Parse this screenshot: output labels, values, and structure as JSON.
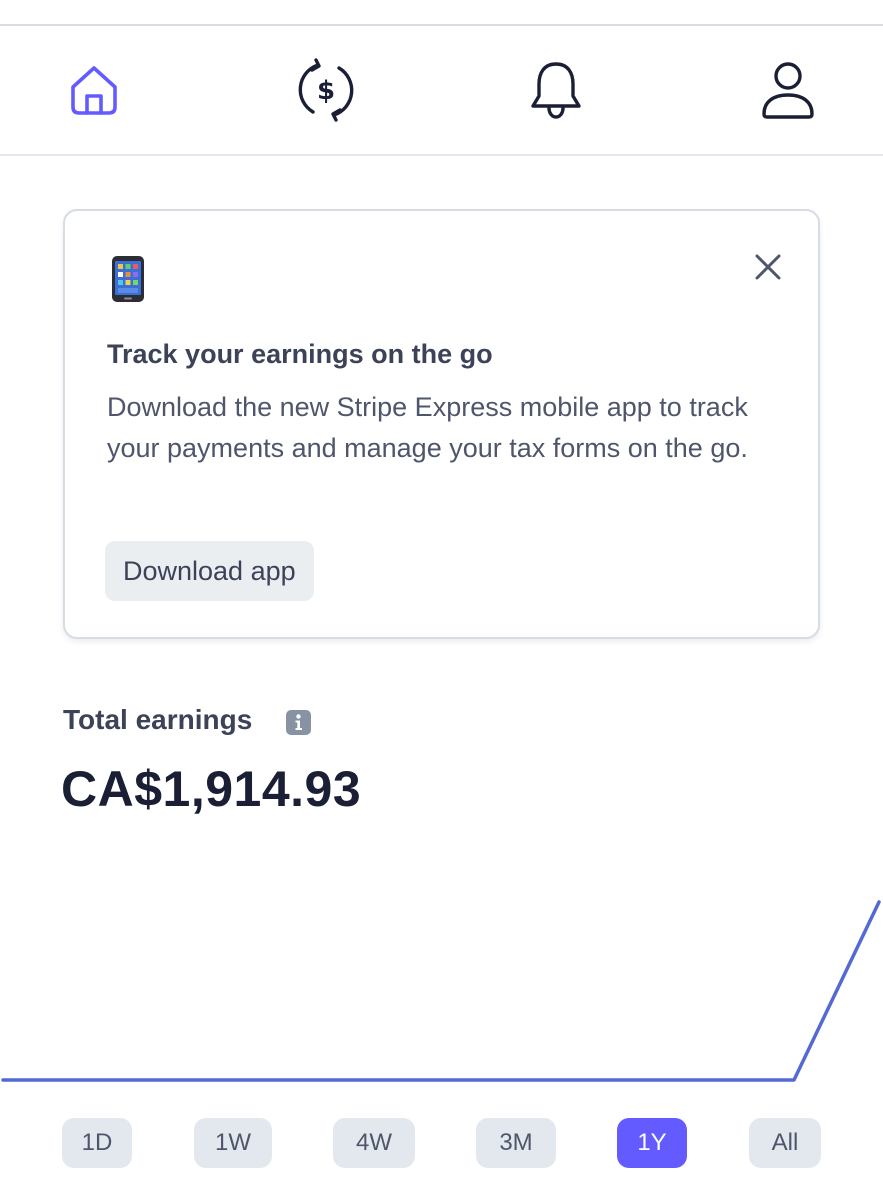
{
  "nav": {
    "items": [
      {
        "name": "home",
        "icon": "home-icon",
        "active": true
      },
      {
        "name": "payments",
        "icon": "currency-exchange-icon",
        "active": false
      },
      {
        "name": "notifications",
        "icon": "bell-icon",
        "active": false
      },
      {
        "name": "account",
        "icon": "user-icon",
        "active": false
      }
    ],
    "active_color": "#635bff",
    "inactive_color": "#1a1f36"
  },
  "promo": {
    "icon": "mobile-phone-icon",
    "title": "Track your earnings on the go",
    "body": "Download the new Stripe Express mobile app to track your payments and manage your tax forms on the go.",
    "button_label": "Download app",
    "close_icon": "close-icon"
  },
  "earnings": {
    "label": "Total earnings",
    "info_icon": "info-icon",
    "amount": "CA$1,914.93"
  },
  "chart_data": {
    "type": "line",
    "title": "",
    "xlabel": "",
    "ylabel": "",
    "grid": false,
    "line_color": "#5469d4",
    "x": [
      0,
      0.903,
      1.0
    ],
    "y": [
      0,
      0,
      1914.93
    ],
    "ylim": [
      0,
      1914.93
    ]
  },
  "time_ranges": {
    "selected": "1Y",
    "options": [
      "1D",
      "1W",
      "4W",
      "3M",
      "1Y",
      "All"
    ]
  },
  "colors": {
    "accent": "#635bff",
    "chip_bg": "#e3e8ee",
    "text_dark": "#1a1f36"
  }
}
